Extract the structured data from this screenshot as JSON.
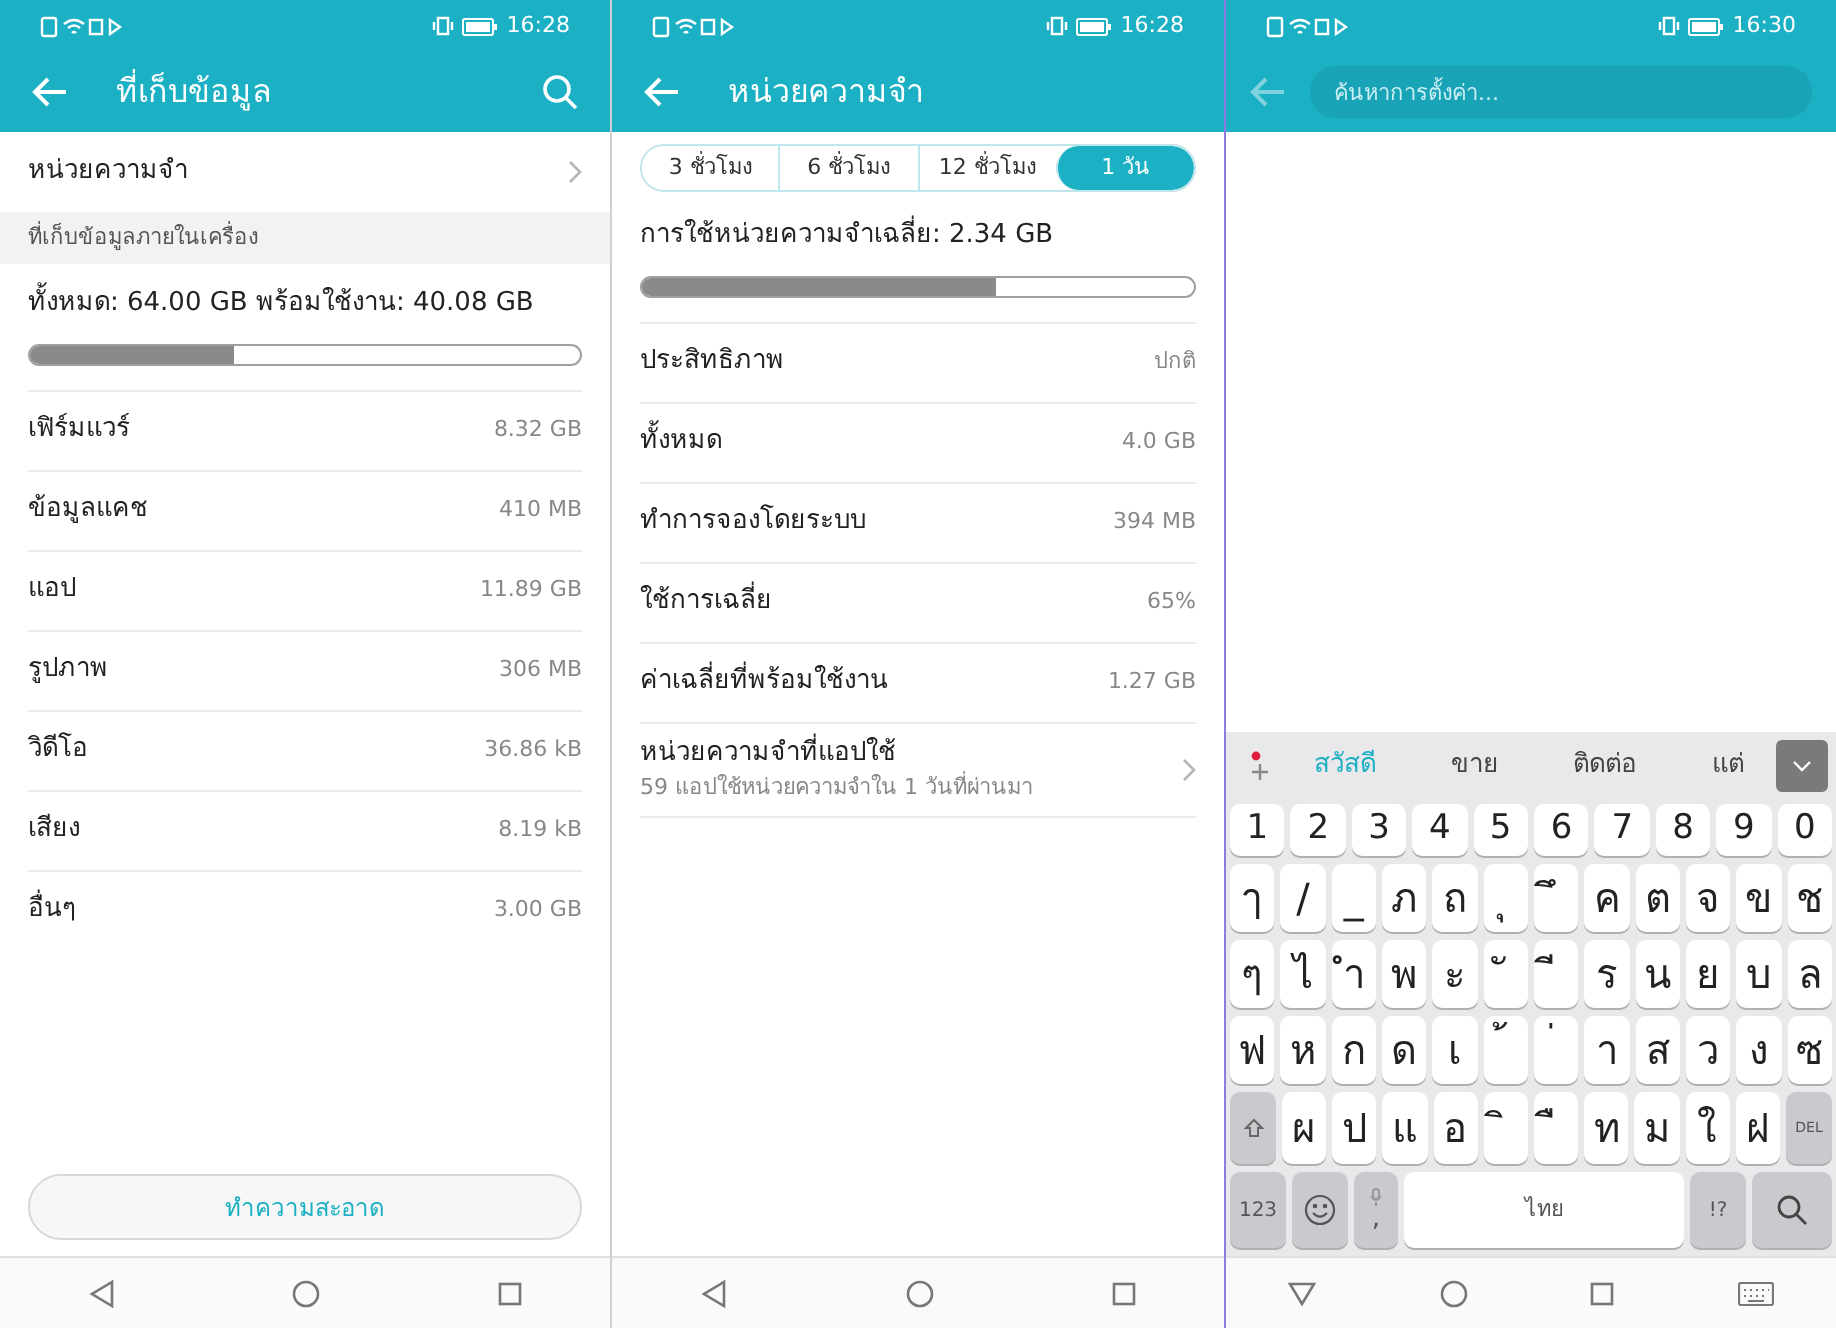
{
  "storage_screen": {
    "status_bar": {
      "time": "16:28"
    },
    "title": "ที่เก็บข้อมูล",
    "memory_row": {
      "label": "หน่วยความจำ"
    },
    "section_header": "ที่เก็บข้อมูลภายในเครื่อง",
    "summary": "ทั้งหมด: 64.00 GB พร้อมใช้งาน: 40.08 GB",
    "usage": {
      "level": 0.37
    },
    "items": [
      {
        "label": "เฟิร์มแวร์",
        "value": "8.32 GB"
      },
      {
        "label": "ข้อมูลแคช",
        "value": "410 MB"
      },
      {
        "label": "แอป",
        "value": "11.89 GB"
      },
      {
        "label": "รูปภาพ",
        "value": "306 MB"
      },
      {
        "label": "วิดีโอ",
        "value": "36.86 kB"
      },
      {
        "label": "เสียง",
        "value": "8.19 kB"
      },
      {
        "label": "อื่นๆ",
        "value": "3.00 GB"
      }
    ],
    "clean_button": "ทำความสะอาด"
  },
  "memory_screen": {
    "status_bar": {
      "time": "16:28"
    },
    "title": "หน่วยความจำ",
    "tabs": [
      {
        "label": "3 ชั่วโมง",
        "selected": false
      },
      {
        "label": "6 ชั่วโมง",
        "selected": false
      },
      {
        "label": "12 ชั่วโมง",
        "selected": false
      },
      {
        "label": "1 วัน",
        "selected": true
      }
    ],
    "average": "การใช้หน่วยความจำเฉลี่ย: 2.34 GB",
    "usage": {
      "level": 0.64
    },
    "rows": [
      {
        "kind": "value",
        "label": "ประสิทธิภาพ",
        "value": "ปกติ"
      },
      {
        "kind": "value",
        "label": "ทั้งหมด",
        "value": "4.0 GB"
      },
      {
        "kind": "value",
        "label": "ทำการจองโดยระบบ",
        "value": "394 MB"
      },
      {
        "kind": "value",
        "label": "ใช้การเฉลี่ย",
        "value": "65%"
      },
      {
        "kind": "value",
        "label": "ค่าเฉลี่ยที่พร้อมใช้งาน",
        "value": "1.27 GB"
      },
      {
        "kind": "link",
        "label": "หน่วยความจำที่แอปใช้",
        "subtitle": "59 แอปใช้หน่วยความจำใน 1 วันที่ผ่านมา"
      }
    ]
  },
  "search_screen": {
    "status_bar": {
      "time": "16:30"
    },
    "search": {
      "placeholder": "ค้นหาการตั้งค่า..."
    },
    "keyboard": {
      "suggestions": [
        {
          "label": "สวัสดี",
          "selected": true
        },
        {
          "label": "ขาย",
          "selected": false
        },
        {
          "label": "ติดต่อ",
          "selected": false
        },
        {
          "label": "แต่",
          "selected": false
        }
      ],
      "rows": [
        {
          "keys": [
            {
              "kind": "num",
              "label": "1"
            },
            {
              "kind": "num",
              "label": "2"
            },
            {
              "kind": "num",
              "label": "3"
            },
            {
              "kind": "num",
              "label": "4"
            },
            {
              "kind": "num",
              "label": "5"
            },
            {
              "kind": "num",
              "label": "6"
            },
            {
              "kind": "num",
              "label": "7"
            },
            {
              "kind": "num",
              "label": "8"
            },
            {
              "kind": "num",
              "label": "9"
            },
            {
              "kind": "num",
              "label": "0"
            }
          ]
        },
        {
          "keys": [
            {
              "kind": "char",
              "label": "ๅ"
            },
            {
              "kind": "char",
              "label": "/"
            },
            {
              "kind": "char",
              "label": "_"
            },
            {
              "kind": "char",
              "label": "ภ"
            },
            {
              "kind": "char",
              "label": "ถ"
            },
            {
              "kind": "char",
              "label": "ุ"
            },
            {
              "kind": "char",
              "label": "ึ"
            },
            {
              "kind": "char",
              "label": "ค"
            },
            {
              "kind": "char",
              "label": "ต"
            },
            {
              "kind": "char",
              "label": "จ"
            },
            {
              "kind": "char",
              "label": "ข"
            },
            {
              "kind": "char",
              "label": "ช"
            }
          ]
        },
        {
          "keys": [
            {
              "kind": "char",
              "label": "ๆ"
            },
            {
              "kind": "char",
              "label": "ไ"
            },
            {
              "kind": "char",
              "label": "ำ"
            },
            {
              "kind": "char",
              "label": "พ"
            },
            {
              "kind": "char",
              "label": "ะ"
            },
            {
              "kind": "char",
              "label": "ั"
            },
            {
              "kind": "char",
              "label": "ี"
            },
            {
              "kind": "char",
              "label": "ร"
            },
            {
              "kind": "char",
              "label": "น"
            },
            {
              "kind": "char",
              "label": "ย"
            },
            {
              "kind": "char",
              "label": "บ"
            },
            {
              "kind": "char",
              "label": "ล"
            }
          ]
        },
        {
          "keys": [
            {
              "kind": "char",
              "label": "ฟ"
            },
            {
              "kind": "char",
              "label": "ห"
            },
            {
              "kind": "char",
              "label": "ก"
            },
            {
              "kind": "char",
              "label": "ด"
            },
            {
              "kind": "char",
              "label": "เ"
            },
            {
              "kind": "char",
              "label": "้"
            },
            {
              "kind": "char",
              "label": "่"
            },
            {
              "kind": "char",
              "label": "า"
            },
            {
              "kind": "char",
              "label": "ส"
            },
            {
              "kind": "char",
              "label": "ว"
            },
            {
              "kind": "char",
              "label": "ง"
            },
            {
              "kind": "char",
              "label": "ซ"
            }
          ]
        },
        {
          "keys": [
            {
              "kind": "shift"
            },
            {
              "kind": "char",
              "label": "ผ"
            },
            {
              "kind": "char",
              "label": "ป"
            },
            {
              "kind": "char",
              "label": "แ"
            },
            {
              "kind": "char",
              "label": "อ"
            },
            {
              "kind": "char",
              "label": "ิ"
            },
            {
              "kind": "char",
              "label": "ื"
            },
            {
              "kind": "char",
              "label": "ท"
            },
            {
              "kind": "char",
              "label": "ม"
            },
            {
              "kind": "char",
              "label": "ใ"
            },
            {
              "kind": "char",
              "label": "ฝ"
            },
            {
              "kind": "delete",
              "label": "DEL"
            }
          ]
        },
        {
          "keys": [
            {
              "kind": "mode",
              "label": "123"
            },
            {
              "kind": "emoji"
            },
            {
              "kind": "mic",
              "label": ","
            },
            {
              "kind": "space",
              "label": "ไทย"
            },
            {
              "kind": "symbols",
              "label": "!?"
            },
            {
              "kind": "search"
            }
          ]
        }
      ]
    }
  }
}
